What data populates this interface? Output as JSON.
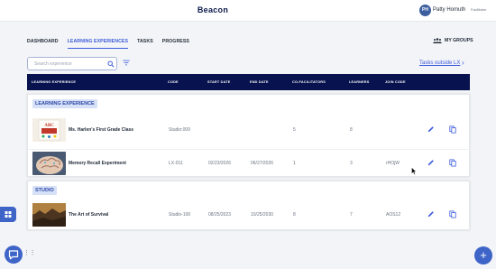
{
  "app": {
    "title": "Beacon"
  },
  "user": {
    "initials": "PH",
    "name": "Patty Homuth",
    "role": "Facilitator"
  },
  "tabs": [
    {
      "label": "DASHBOARD",
      "active": false
    },
    {
      "label": "LEARNING EXPERIENCES",
      "active": true
    },
    {
      "label": "TASKS",
      "active": false
    },
    {
      "label": "PROGRESS",
      "active": false
    }
  ],
  "my_groups_label": "MY GROUPS",
  "search": {
    "placeholder": "Search experience"
  },
  "tasks_outside_label": "Tasks outside LX",
  "table": {
    "headers": [
      "LEARNING EXPERIENCE",
      "CODE",
      "START DATE",
      "END DATE",
      "CO-FACILITATORS",
      "LEARNERS",
      "JOIN CODE"
    ]
  },
  "groups": [
    {
      "label": "LEARNING EXPERIENCE",
      "rows": [
        {
          "name": "Ms. Harlen's First Grade Class",
          "code": "Studio:009",
          "start": "",
          "end": "",
          "co": "5",
          "learners": "8",
          "join": "",
          "thumb": "poster-icon"
        },
        {
          "name": "Memory Recall Experiment",
          "code": "LX-011",
          "start": "02/23/2026",
          "end": "06/27/2026",
          "co": "1",
          "learners": "3",
          "join": "rHOjW",
          "thumb": "brain-icon"
        }
      ]
    },
    {
      "label": "STUDIO",
      "rows": [
        {
          "name": "The Art of Survival",
          "code": "Studio-100",
          "start": "08/25/2023",
          "end": "10/25/2030",
          "co": "8",
          "learners": "7",
          "join": "AOS12",
          "thumb": "landscape-icon"
        }
      ]
    }
  ],
  "colors": {
    "navy": "#07124e",
    "accent": "#3b5bdb",
    "fab": "#3e64c8"
  }
}
